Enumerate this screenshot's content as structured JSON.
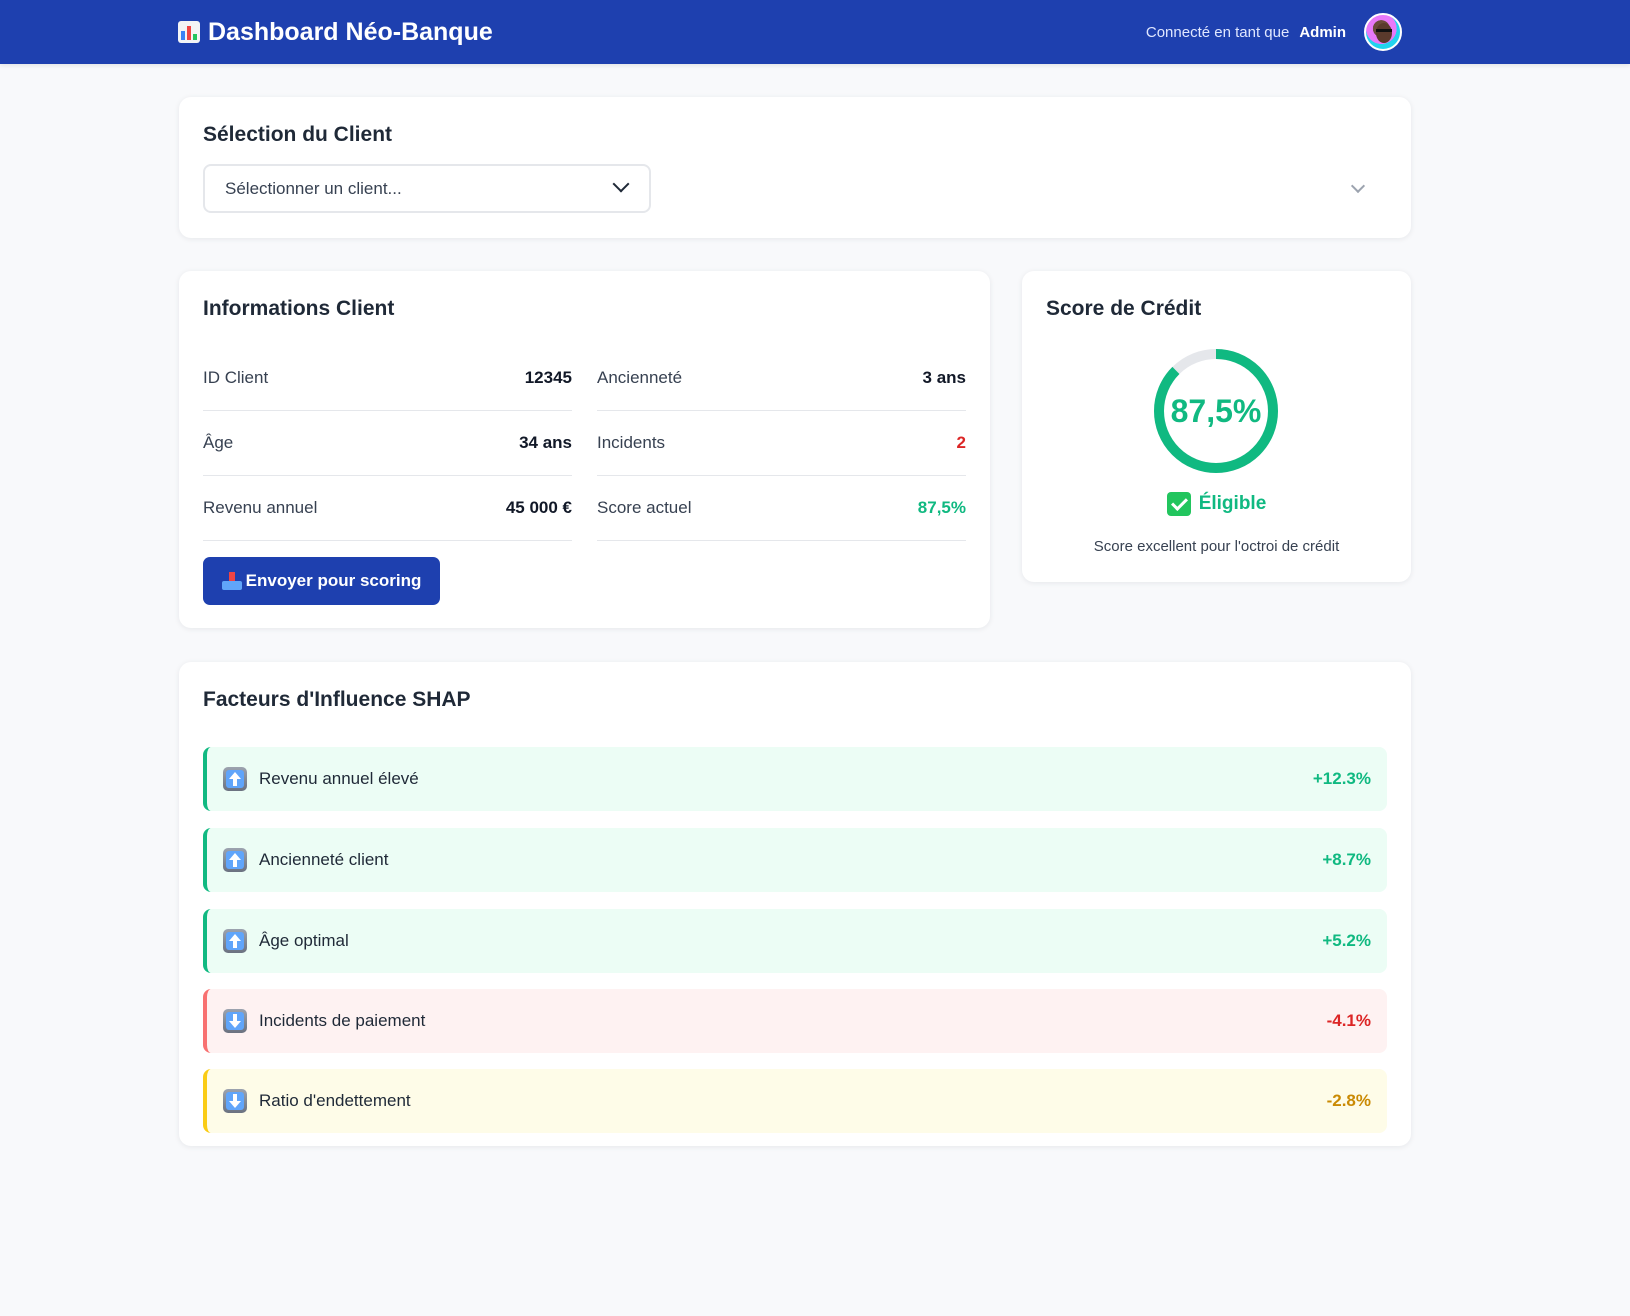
{
  "header": {
    "title": "Dashboard Néo-Banque",
    "icon": "bar-chart-icon",
    "connected_label": "Connecté en tant que",
    "user_name": "Admin",
    "background_color": "#1e40af"
  },
  "client_selection": {
    "title": "Sélection du Client",
    "select_placeholder": "Sélectionner un client..."
  },
  "client_info": {
    "title": "Informations Client",
    "fields": [
      {
        "label": "ID Client",
        "value": "12345"
      },
      {
        "label": "Ancienneté",
        "value": "3 ans"
      },
      {
        "label": "Âge",
        "value": "34 ans"
      },
      {
        "label": "Incidents",
        "value": "2"
      },
      {
        "label": "Revenu annuel",
        "value": "45 000 €"
      },
      {
        "label": "Score actuel",
        "value": "87,5%"
      }
    ],
    "send_button_label": "Envoyer pour scoring"
  },
  "credit_score": {
    "title": "Score de Crédit",
    "value_text": "87,5%",
    "value_fraction": 0.875,
    "status": "Éligible",
    "description": "Score excellent pour l'octroi de crédit",
    "accent_color": "#10b981"
  },
  "shap": {
    "title": "Facteurs d'Influence SHAP",
    "factors": [
      {
        "name": "Revenu annuel élevé",
        "impact": "+12.3%",
        "direction": "up"
      },
      {
        "name": "Ancienneté client",
        "impact": "+8.7%",
        "direction": "up"
      },
      {
        "name": "Âge optimal",
        "impact": "+5.2%",
        "direction": "up"
      },
      {
        "name": "Incidents de paiement",
        "impact": "-4.1%",
        "direction": "down"
      },
      {
        "name": "Ratio d'endettement",
        "impact": "-2.8%",
        "direction": "down"
      }
    ]
  }
}
